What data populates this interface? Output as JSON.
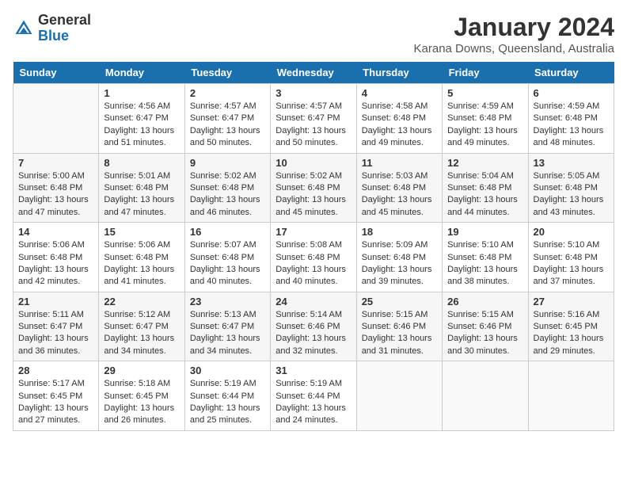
{
  "header": {
    "logo_general": "General",
    "logo_blue": "Blue",
    "month": "January 2024",
    "location": "Karana Downs, Queensland, Australia"
  },
  "days_of_week": [
    "Sunday",
    "Monday",
    "Tuesday",
    "Wednesday",
    "Thursday",
    "Friday",
    "Saturday"
  ],
  "weeks": [
    [
      {
        "day": "",
        "empty": true
      },
      {
        "day": "1",
        "sunrise": "Sunrise: 4:56 AM",
        "sunset": "Sunset: 6:47 PM",
        "daylight": "Daylight: 13 hours and 51 minutes."
      },
      {
        "day": "2",
        "sunrise": "Sunrise: 4:57 AM",
        "sunset": "Sunset: 6:47 PM",
        "daylight": "Daylight: 13 hours and 50 minutes."
      },
      {
        "day": "3",
        "sunrise": "Sunrise: 4:57 AM",
        "sunset": "Sunset: 6:47 PM",
        "daylight": "Daylight: 13 hours and 50 minutes."
      },
      {
        "day": "4",
        "sunrise": "Sunrise: 4:58 AM",
        "sunset": "Sunset: 6:48 PM",
        "daylight": "Daylight: 13 hours and 49 minutes."
      },
      {
        "day": "5",
        "sunrise": "Sunrise: 4:59 AM",
        "sunset": "Sunset: 6:48 PM",
        "daylight": "Daylight: 13 hours and 49 minutes."
      },
      {
        "day": "6",
        "sunrise": "Sunrise: 4:59 AM",
        "sunset": "Sunset: 6:48 PM",
        "daylight": "Daylight: 13 hours and 48 minutes."
      }
    ],
    [
      {
        "day": "7",
        "sunrise": "Sunrise: 5:00 AM",
        "sunset": "Sunset: 6:48 PM",
        "daylight": "Daylight: 13 hours and 47 minutes."
      },
      {
        "day": "8",
        "sunrise": "Sunrise: 5:01 AM",
        "sunset": "Sunset: 6:48 PM",
        "daylight": "Daylight: 13 hours and 47 minutes."
      },
      {
        "day": "9",
        "sunrise": "Sunrise: 5:02 AM",
        "sunset": "Sunset: 6:48 PM",
        "daylight": "Daylight: 13 hours and 46 minutes."
      },
      {
        "day": "10",
        "sunrise": "Sunrise: 5:02 AM",
        "sunset": "Sunset: 6:48 PM",
        "daylight": "Daylight: 13 hours and 45 minutes."
      },
      {
        "day": "11",
        "sunrise": "Sunrise: 5:03 AM",
        "sunset": "Sunset: 6:48 PM",
        "daylight": "Daylight: 13 hours and 45 minutes."
      },
      {
        "day": "12",
        "sunrise": "Sunrise: 5:04 AM",
        "sunset": "Sunset: 6:48 PM",
        "daylight": "Daylight: 13 hours and 44 minutes."
      },
      {
        "day": "13",
        "sunrise": "Sunrise: 5:05 AM",
        "sunset": "Sunset: 6:48 PM",
        "daylight": "Daylight: 13 hours and 43 minutes."
      }
    ],
    [
      {
        "day": "14",
        "sunrise": "Sunrise: 5:06 AM",
        "sunset": "Sunset: 6:48 PM",
        "daylight": "Daylight: 13 hours and 42 minutes."
      },
      {
        "day": "15",
        "sunrise": "Sunrise: 5:06 AM",
        "sunset": "Sunset: 6:48 PM",
        "daylight": "Daylight: 13 hours and 41 minutes."
      },
      {
        "day": "16",
        "sunrise": "Sunrise: 5:07 AM",
        "sunset": "Sunset: 6:48 PM",
        "daylight": "Daylight: 13 hours and 40 minutes."
      },
      {
        "day": "17",
        "sunrise": "Sunrise: 5:08 AM",
        "sunset": "Sunset: 6:48 PM",
        "daylight": "Daylight: 13 hours and 40 minutes."
      },
      {
        "day": "18",
        "sunrise": "Sunrise: 5:09 AM",
        "sunset": "Sunset: 6:48 PM",
        "daylight": "Daylight: 13 hours and 39 minutes."
      },
      {
        "day": "19",
        "sunrise": "Sunrise: 5:10 AM",
        "sunset": "Sunset: 6:48 PM",
        "daylight": "Daylight: 13 hours and 38 minutes."
      },
      {
        "day": "20",
        "sunrise": "Sunrise: 5:10 AM",
        "sunset": "Sunset: 6:48 PM",
        "daylight": "Daylight: 13 hours and 37 minutes."
      }
    ],
    [
      {
        "day": "21",
        "sunrise": "Sunrise: 5:11 AM",
        "sunset": "Sunset: 6:47 PM",
        "daylight": "Daylight: 13 hours and 36 minutes."
      },
      {
        "day": "22",
        "sunrise": "Sunrise: 5:12 AM",
        "sunset": "Sunset: 6:47 PM",
        "daylight": "Daylight: 13 hours and 34 minutes."
      },
      {
        "day": "23",
        "sunrise": "Sunrise: 5:13 AM",
        "sunset": "Sunset: 6:47 PM",
        "daylight": "Daylight: 13 hours and 34 minutes."
      },
      {
        "day": "24",
        "sunrise": "Sunrise: 5:14 AM",
        "sunset": "Sunset: 6:46 PM",
        "daylight": "Daylight: 13 hours and 32 minutes."
      },
      {
        "day": "25",
        "sunrise": "Sunrise: 5:15 AM",
        "sunset": "Sunset: 6:46 PM",
        "daylight": "Daylight: 13 hours and 31 minutes."
      },
      {
        "day": "26",
        "sunrise": "Sunrise: 5:15 AM",
        "sunset": "Sunset: 6:46 PM",
        "daylight": "Daylight: 13 hours and 30 minutes."
      },
      {
        "day": "27",
        "sunrise": "Sunrise: 5:16 AM",
        "sunset": "Sunset: 6:45 PM",
        "daylight": "Daylight: 13 hours and 29 minutes."
      }
    ],
    [
      {
        "day": "28",
        "sunrise": "Sunrise: 5:17 AM",
        "sunset": "Sunset: 6:45 PM",
        "daylight": "Daylight: 13 hours and 27 minutes."
      },
      {
        "day": "29",
        "sunrise": "Sunrise: 5:18 AM",
        "sunset": "Sunset: 6:45 PM",
        "daylight": "Daylight: 13 hours and 26 minutes."
      },
      {
        "day": "30",
        "sunrise": "Sunrise: 5:19 AM",
        "sunset": "Sunset: 6:44 PM",
        "daylight": "Daylight: 13 hours and 25 minutes."
      },
      {
        "day": "31",
        "sunrise": "Sunrise: 5:19 AM",
        "sunset": "Sunset: 6:44 PM",
        "daylight": "Daylight: 13 hours and 24 minutes."
      },
      {
        "day": "",
        "empty": true
      },
      {
        "day": "",
        "empty": true
      },
      {
        "day": "",
        "empty": true
      }
    ]
  ]
}
